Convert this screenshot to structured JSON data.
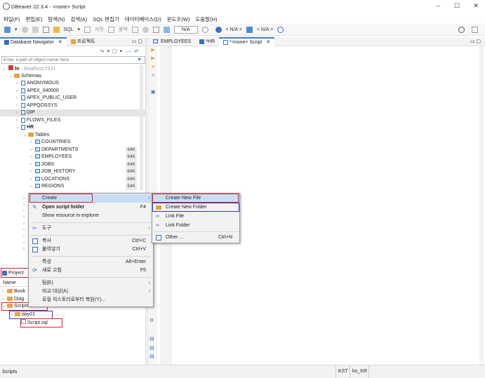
{
  "window": {
    "title": "DBeaver 22.3.4 - <none> Script",
    "controls": [
      "–",
      "☐",
      "✕"
    ]
  },
  "menu": [
    "파일(F)",
    "편집(E)",
    "탐색(N)",
    "검색(A)",
    "SQL 편집기",
    "데이터베이스(D)",
    "윈도우(W)",
    "도움말(H)"
  ],
  "toolbar": {
    "sql_label": "SQL",
    "commit_label": "커밋",
    "rollback_label": "롤백",
    "na_box": "N/A",
    "datasource_label": "< N/A >",
    "schema_label": "< N/A >"
  },
  "left_tabs": [
    {
      "label": "Database Navigator"
    },
    {
      "label": "프로젝트"
    }
  ],
  "editor_tabs": [
    {
      "label": "EMPLOYEES"
    },
    {
      "label": "*HR"
    },
    {
      "label": "*<none> Script"
    }
  ],
  "navigator": {
    "filter_placeholder": "Enter a part of object name here",
    "connection": "hr",
    "connection_host": "- localhost:1521",
    "schemas_label": "Schemas",
    "schemas": [
      "ANONYMOUS",
      "APEX_040000",
      "APEX_PUBLIC_USER",
      "APPQOSSYS",
      "DIP",
      "FLOWS_FILES",
      "HR"
    ],
    "tables_label": "Tables",
    "tables": [
      {
        "name": "COUNTRIES",
        "size": ""
      },
      {
        "name": "DEPARTMENTS",
        "size": "64K"
      },
      {
        "name": "EMPLOYEES",
        "size": "64K"
      },
      {
        "name": "JOBS",
        "size": "64K"
      },
      {
        "name": "JOB_HISTORY",
        "size": "64K"
      },
      {
        "name": "LOCATIONS",
        "size": "64K"
      },
      {
        "name": "REGIONS",
        "size": "64K"
      }
    ]
  },
  "project_panel": {
    "tab_label": "Project",
    "column_name": "Name",
    "items": [
      {
        "label": "Book"
      },
      {
        "label": "Diag"
      },
      {
        "label": "Scripts"
      },
      {
        "label": "day01"
      },
      {
        "label": "Script.sql"
      }
    ]
  },
  "context_menu": {
    "items": [
      {
        "label": "Create",
        "key": "",
        "submenu": true
      },
      {
        "label": "Open script folder",
        "key": "F4",
        "submenu": false
      },
      {
        "label": "Show resource in explorer",
        "key": "",
        "submenu": false
      },
      {
        "label": "도구",
        "key": "",
        "submenu": true
      },
      {
        "label": "복사",
        "key": "Ctrl+C",
        "submenu": false
      },
      {
        "label": "붙여넣기",
        "key": "Ctrl+V",
        "submenu": false
      },
      {
        "label": "특성",
        "key": "Alt+Enter",
        "submenu": false
      },
      {
        "label": "새로 고침",
        "key": "F5",
        "submenu": false
      },
      {
        "label": "팀(E)",
        "key": "",
        "submenu": true
      },
      {
        "label": "비교 대상(A)",
        "key": "",
        "submenu": true
      },
      {
        "label": "로컬 히스토리로부터 복원(Y)...",
        "key": "",
        "submenu": false
      }
    ]
  },
  "create_submenu": {
    "items": [
      {
        "label": "Create New File",
        "key": ""
      },
      {
        "label": "Create New Folder",
        "key": ""
      },
      {
        "label": "Link File",
        "key": ""
      },
      {
        "label": "Link Folder",
        "key": ""
      },
      {
        "label": "Other ...",
        "key": "Ctrl+N"
      }
    ]
  },
  "statusbar": {
    "left": "Scripts",
    "timezone": "KST",
    "locale": "ko_KR"
  },
  "colors": {
    "highlight_red": "#e21a2a",
    "highlight_blue": "#2c3cc8",
    "folder": "#e8a33c",
    "accent": "#3b7bd4"
  }
}
